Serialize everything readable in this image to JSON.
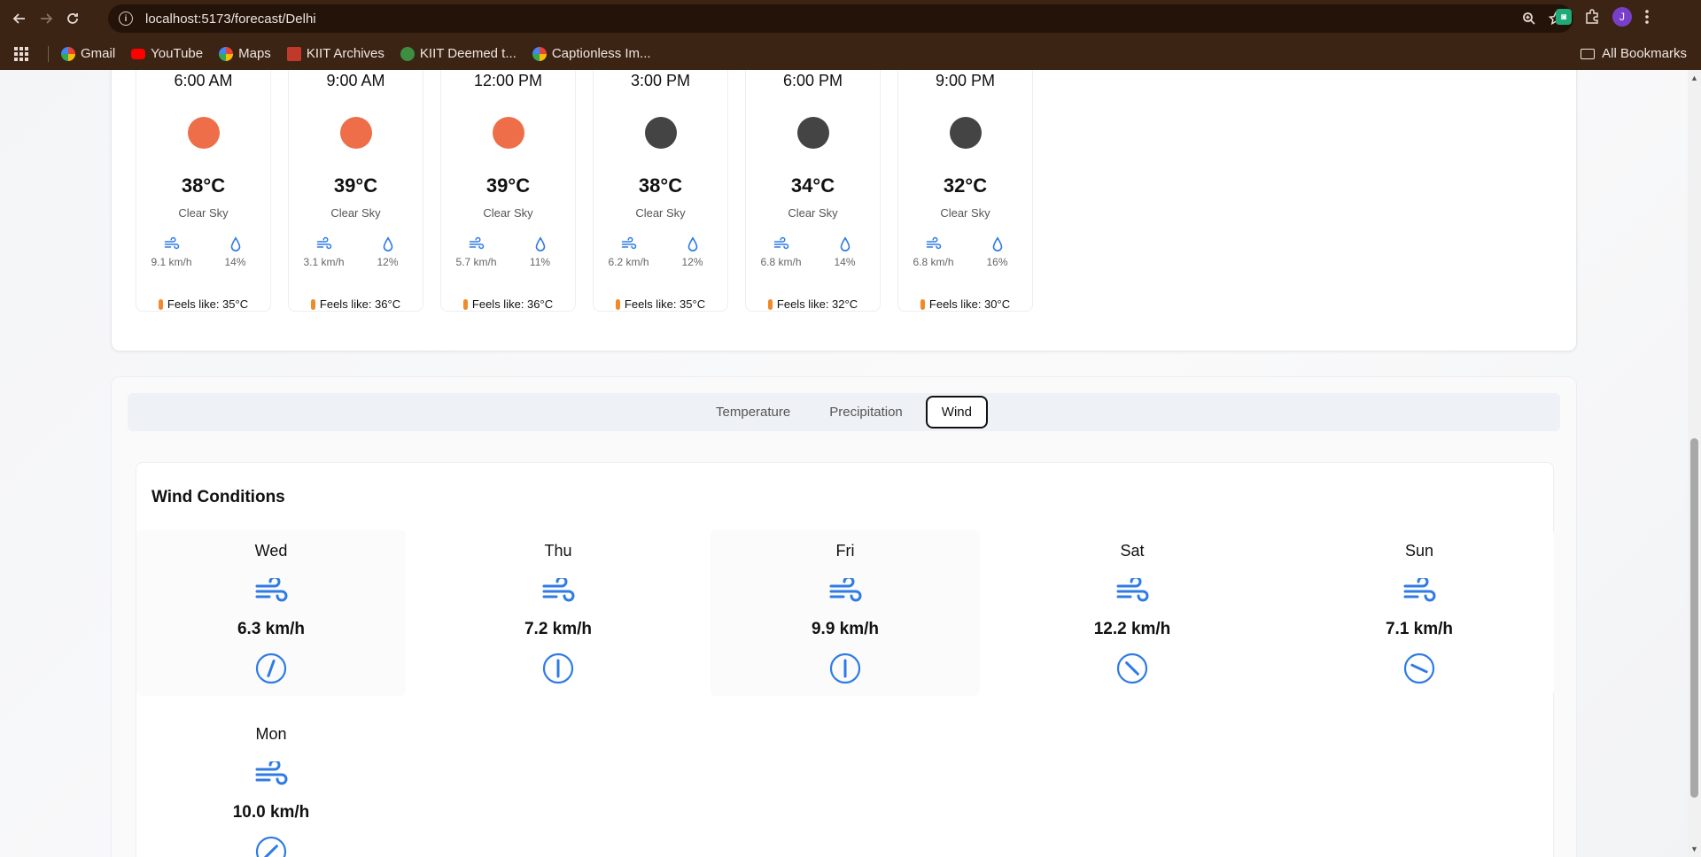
{
  "browser": {
    "url": "localhost:5173/forecast/Delhi",
    "bookmarks": [
      "Gmail",
      "YouTube",
      "Maps",
      "KIIT Archives",
      "KIIT Deemed t...",
      "Captionless Im..."
    ],
    "all_bookmarks_label": "All Bookmarks",
    "avatar_letter": "J"
  },
  "hourly": [
    {
      "time": "6:00 AM",
      "temp": "38°C",
      "condition": "Clear Sky",
      "wind": "9.1 km/h",
      "humidity": "14%",
      "feels": "Feels like: 35°C",
      "dot_color": "#ee6e4a"
    },
    {
      "time": "9:00 AM",
      "temp": "39°C",
      "condition": "Clear Sky",
      "wind": "3.1 km/h",
      "humidity": "12%",
      "feels": "Feels like: 36°C",
      "dot_color": "#ee6e4a"
    },
    {
      "time": "12:00 PM",
      "temp": "39°C",
      "condition": "Clear Sky",
      "wind": "5.7 km/h",
      "humidity": "11%",
      "feels": "Feels like: 36°C",
      "dot_color": "#ee6e4a"
    },
    {
      "time": "3:00 PM",
      "temp": "38°C",
      "condition": "Clear Sky",
      "wind": "6.2 km/h",
      "humidity": "12%",
      "feels": "Feels like: 35°C",
      "dot_color": "#444444"
    },
    {
      "time": "6:00 PM",
      "temp": "34°C",
      "condition": "Clear Sky",
      "wind": "6.8 km/h",
      "humidity": "14%",
      "feels": "Feels like: 32°C",
      "dot_color": "#444444"
    },
    {
      "time": "9:00 PM",
      "temp": "32°C",
      "condition": "Clear Sky",
      "wind": "6.8 km/h",
      "humidity": "16%",
      "feels": "Feels like: 30°C",
      "dot_color": "#444444"
    }
  ],
  "tabs": {
    "temperature": "Temperature",
    "precipitation": "Precipitation",
    "wind": "Wind",
    "active": "Wind"
  },
  "wind": {
    "title": "Wind Conditions",
    "days": [
      {
        "day": "Wed",
        "speed": "6.3 km/h",
        "direction_deg": 20
      },
      {
        "day": "Thu",
        "speed": "7.2 km/h",
        "direction_deg": 0
      },
      {
        "day": "Fri",
        "speed": "9.9 km/h",
        "direction_deg": 0
      },
      {
        "day": "Sat",
        "speed": "12.2 km/h",
        "direction_deg": 135
      },
      {
        "day": "Sun",
        "speed": "7.1 km/h",
        "direction_deg": 115
      },
      {
        "day": "Mon",
        "speed": "10.0 km/h",
        "direction_deg": 45
      }
    ]
  },
  "colors": {
    "accent": "#2f7be5",
    "sun": "#ee6e4a",
    "moon": "#444444"
  }
}
